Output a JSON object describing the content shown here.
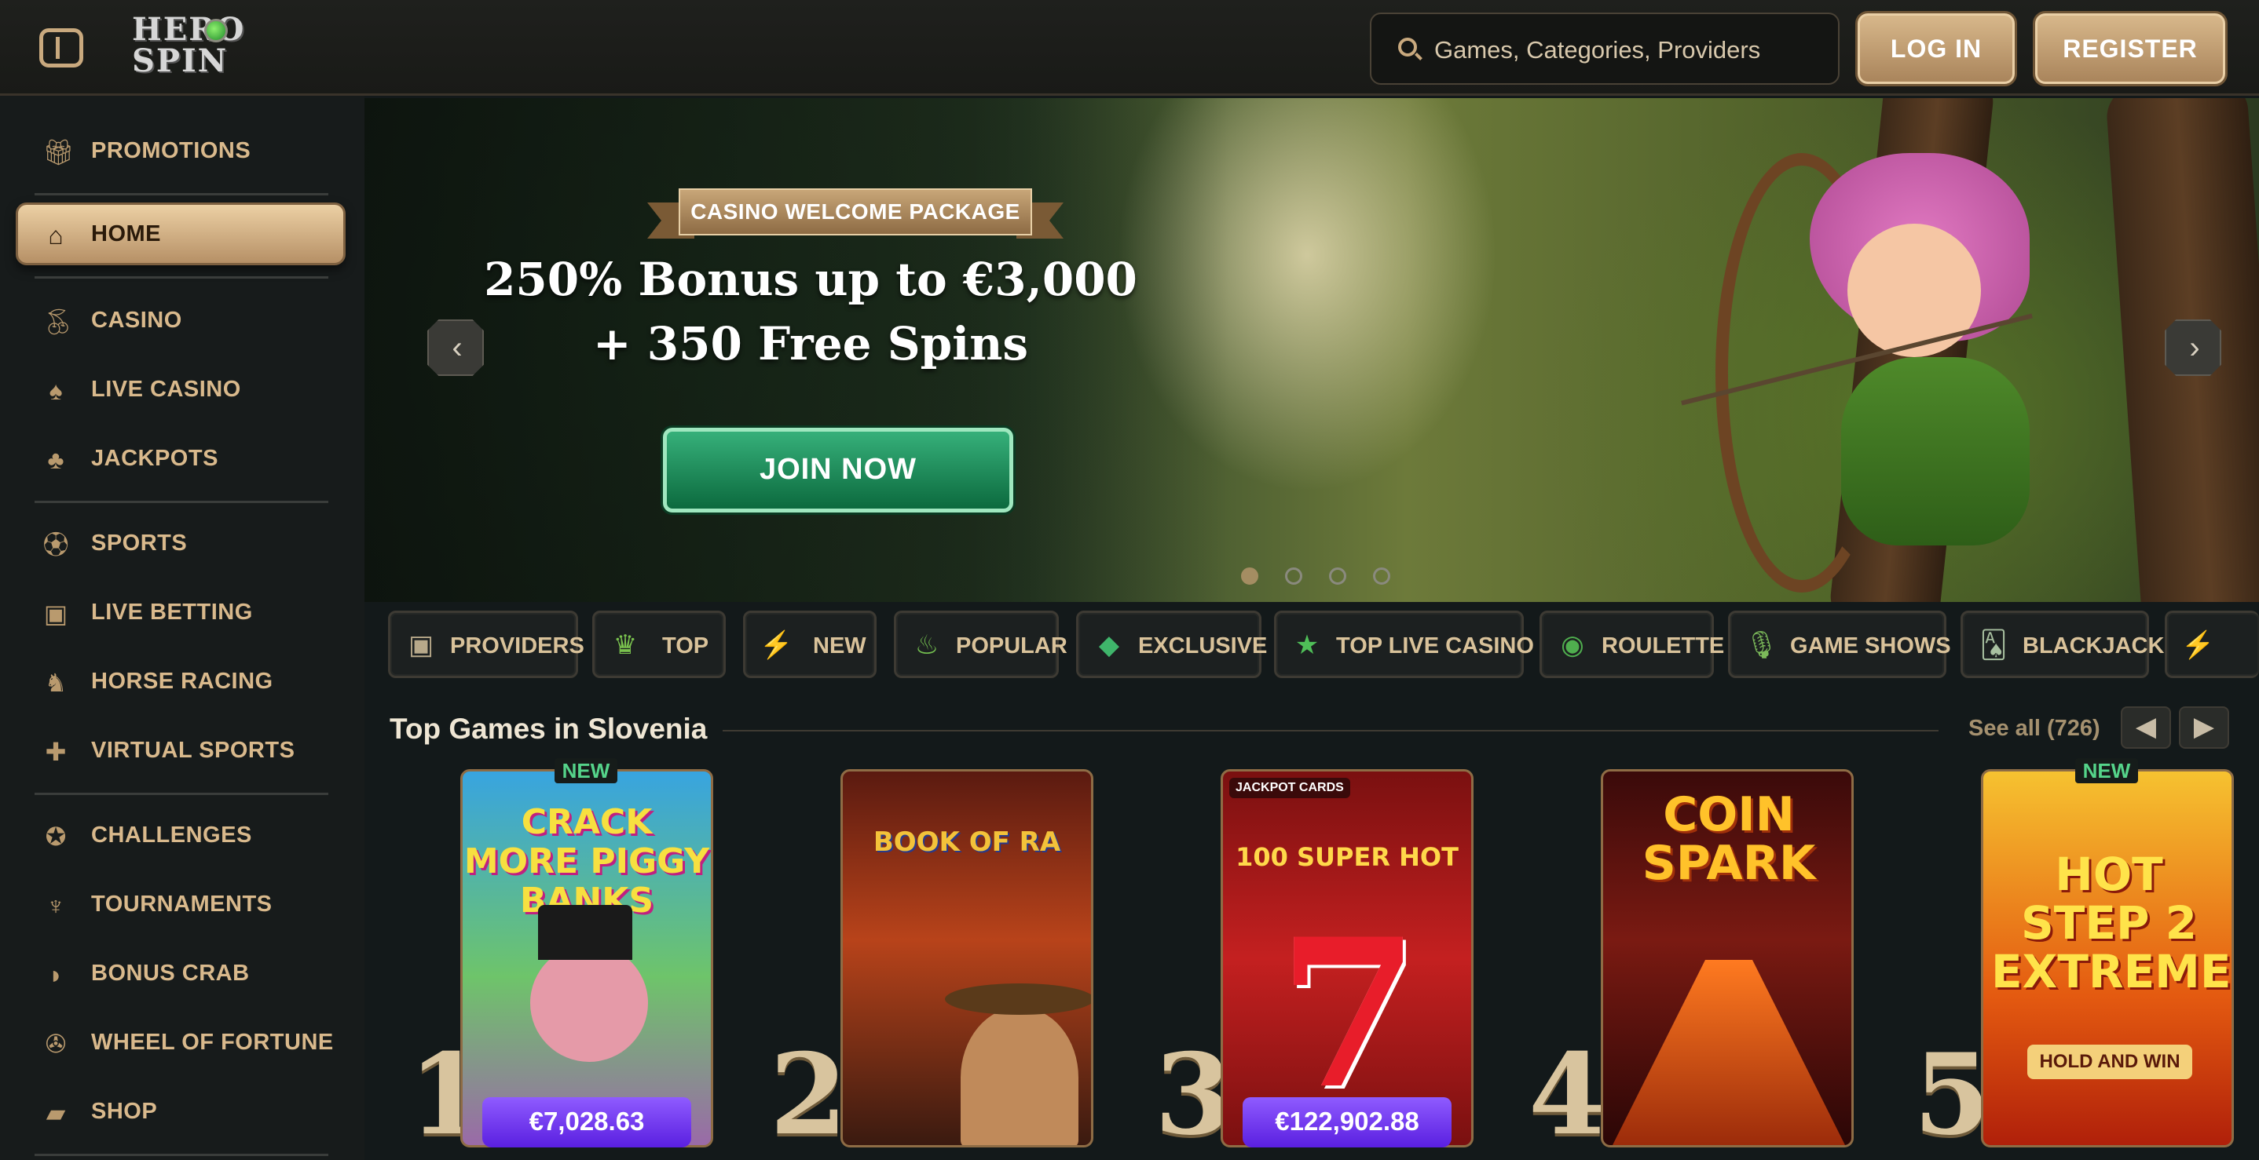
{
  "header": {
    "logo_text": "HERO SPIN",
    "search_placeholder": "Games, Categories, Providers",
    "login_label": "LOG IN",
    "register_label": "REGISTER"
  },
  "sidebar": {
    "items": [
      {
        "label": "PROMOTIONS",
        "icon": "gift-icon",
        "active": false
      },
      {
        "label": "HOME",
        "icon": "home-icon",
        "active": true
      },
      {
        "label": "CASINO",
        "icon": "cherries-icon",
        "active": false
      },
      {
        "label": "LIVE CASINO",
        "icon": "cards-icon",
        "active": false
      },
      {
        "label": "JACKPOTS",
        "icon": "clover-icon",
        "active": false
      },
      {
        "label": "SPORTS",
        "icon": "soccer-ball-icon",
        "active": false
      },
      {
        "label": "LIVE BETTING",
        "icon": "live-screen-icon",
        "active": false
      },
      {
        "label": "HORSE RACING",
        "icon": "horse-icon",
        "active": false
      },
      {
        "label": "VIRTUAL SPORTS",
        "icon": "gamepad-icon",
        "active": false
      },
      {
        "label": "CHALLENGES",
        "icon": "medal-icon",
        "active": false
      },
      {
        "label": "TOURNAMENTS",
        "icon": "trophy-icon",
        "active": false
      },
      {
        "label": "BONUS CRAB",
        "icon": "crab-icon",
        "active": false
      },
      {
        "label": "WHEEL OF FORTUNE",
        "icon": "wheel-icon",
        "active": false
      },
      {
        "label": "SHOP",
        "icon": "shopping-bag-icon",
        "active": false
      }
    ]
  },
  "hero": {
    "ribbon": "CASINO WELCOME PACKAGE",
    "title_line1": "250% Bonus up to €3,000",
    "title_line2": "+ 350 Free Spins",
    "cta": "JOIN NOW",
    "prev_glyph": "‹",
    "next_glyph": "›",
    "active_slide": 1,
    "slide_count": 4
  },
  "categories": [
    {
      "label": "PROVIDERS",
      "icon": "provider-card-icon",
      "glyph": "▣",
      "color": "#b8a98a"
    },
    {
      "label": "TOP",
      "icon": "crown-icon",
      "glyph": "♛",
      "color": "#7ac24e"
    },
    {
      "label": "NEW",
      "icon": "lightning-icon",
      "glyph": "⚡",
      "color": "#6cb84a"
    },
    {
      "label": "POPULAR",
      "icon": "flame-icon",
      "glyph": "♨",
      "color": "#74c050"
    },
    {
      "label": "EXCLUSIVE",
      "icon": "gem-icon",
      "glyph": "◆",
      "color": "#3fb56b"
    },
    {
      "label": "TOP LIVE CASINO",
      "icon": "star-icon",
      "glyph": "★",
      "color": "#4fbf58"
    },
    {
      "label": "ROULETTE",
      "icon": "roulette-icon",
      "glyph": "◉",
      "color": "#4fae4e"
    },
    {
      "label": "GAME SHOWS",
      "icon": "microphone-icon",
      "glyph": "🎙",
      "color": "#7cba5a"
    },
    {
      "label": "BLACKJACK",
      "icon": "playing-cards-icon",
      "glyph": "🂡",
      "color": "#a8c0a0"
    },
    {
      "label": "",
      "icon": "more-icon",
      "glyph": "⚡",
      "color": "#6e8a6e"
    }
  ],
  "top_games": {
    "title": "Top Games in Slovenia",
    "see_all": "See all (726)",
    "prev_glyph": "◀",
    "next_glyph": "▶",
    "games": [
      {
        "rank": "1",
        "name": "CRACK MORE PIGGY BANKS",
        "badge": "NEW",
        "jackpot": "€7,028.63",
        "bg": "linear-gradient(#38a4e0,#6ec46a 55%,#9a6aa8)"
      },
      {
        "rank": "2",
        "name": "BOOK OF RA",
        "badge": "",
        "jackpot": "",
        "bg": "linear-gradient(#5a1a10,#b8431a 45%,#3a1a10)"
      },
      {
        "rank": "3",
        "name": "100 SUPER HOT",
        "badge": "",
        "jackpot": "€122,902.88",
        "sub": "JACKPOT CARDS",
        "bg": "linear-gradient(#7a1010,#c42020 50%,#7a1010)"
      },
      {
        "rank": "4",
        "name": "COIN SPARK",
        "badge": "",
        "jackpot": "",
        "bg": "linear-gradient(#3a0a0a,#7a1a12 45%,#2a0606)"
      },
      {
        "rank": "5",
        "name": "HOT STEP 2 EXTREME",
        "badge": "NEW",
        "jackpot": "",
        "sub": "HOLD AND WIN",
        "bg": "linear-gradient(#f6c230,#e45a10 60%,#b0200a)"
      }
    ]
  }
}
